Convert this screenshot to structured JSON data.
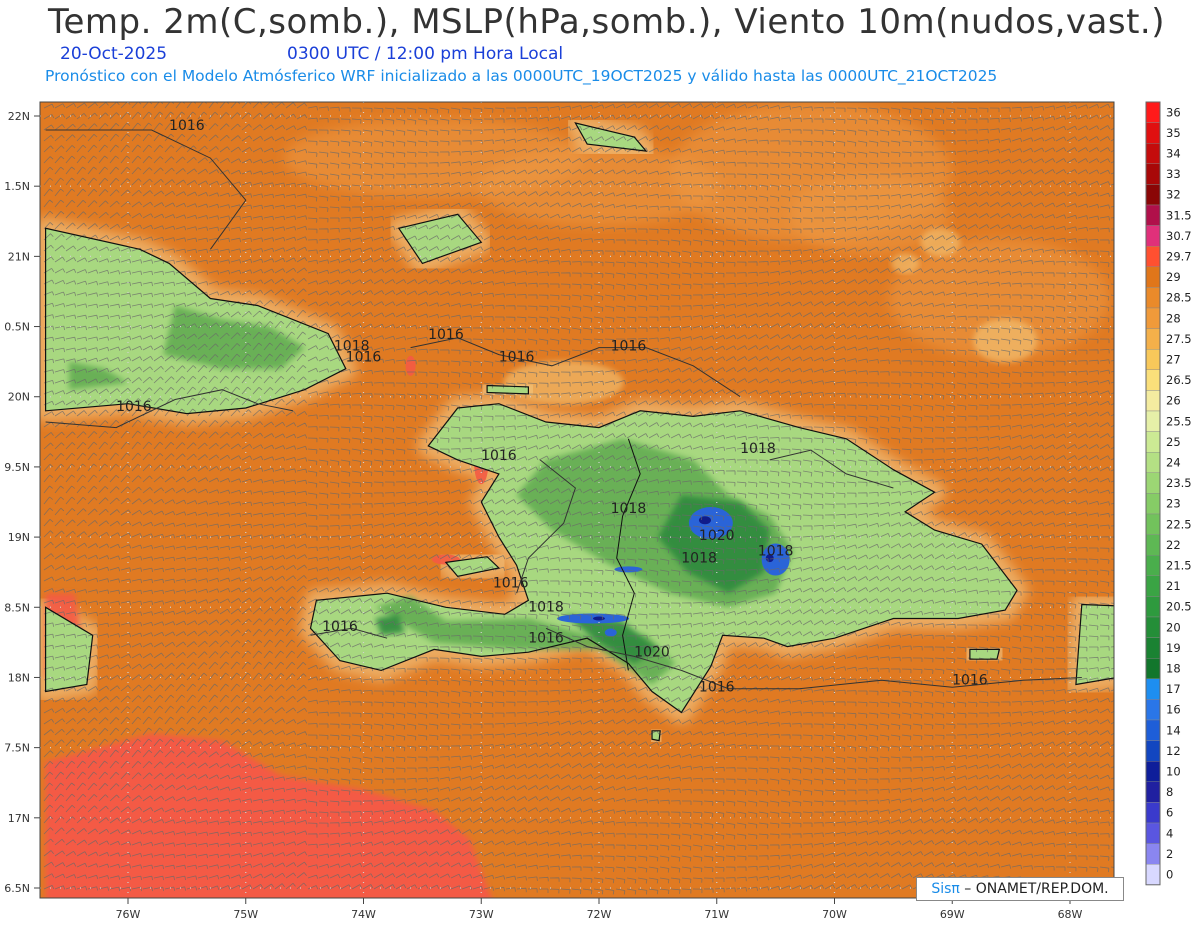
{
  "header": {
    "title": "Temp. 2m(C,somb.), MSLP(hPa,somb.), Viento 10m(nudos,vast.)",
    "date": "20-Oct-2025",
    "time": "0300 UTC / 12:00 pm Hora Local",
    "description": "Pronóstico con el Modelo Atmósferico WRF inicializado a las 0000UTC_19OCT2025 y válido hasta las  0000UTC_21OCT2025"
  },
  "credit": {
    "brand": "Sisπ",
    "org": " – ONAMET/REP.DOM."
  },
  "axes": {
    "lon_labels": [
      "76W",
      "75W",
      "74W",
      "73W",
      "72W",
      "71W",
      "70W",
      "69W",
      "68W"
    ],
    "lat_labels": [
      "22N",
      "1.5N",
      "21N",
      "0.5N",
      "20N",
      "9.5N",
      "19N",
      "8.5N",
      "18N",
      "7.5N",
      "17N",
      "6.5N"
    ]
  },
  "isobar_labels": [
    {
      "text": "1016",
      "lon": -75.5,
      "lat": 21.9
    },
    {
      "text": "1016",
      "lon": -73.3,
      "lat": 20.41
    },
    {
      "text": "1016",
      "lon": -72.7,
      "lat": 20.25
    },
    {
      "text": "1016",
      "lon": -71.75,
      "lat": 20.33
    },
    {
      "text": "1018",
      "lon": -74.1,
      "lat": 20.33
    },
    {
      "text": "1016",
      "lon": -74.0,
      "lat": 20.25
    },
    {
      "text": "1016",
      "lon": -75.95,
      "lat": 19.9
    },
    {
      "text": "1016",
      "lon": -72.85,
      "lat": 19.55
    },
    {
      "text": "1018",
      "lon": -71.75,
      "lat": 19.17
    },
    {
      "text": "1018",
      "lon": -70.65,
      "lat": 19.6
    },
    {
      "text": "1020",
      "lon": -71.0,
      "lat": 18.98
    },
    {
      "text": "1018",
      "lon": -71.15,
      "lat": 18.82
    },
    {
      "text": "1018",
      "lon": -70.5,
      "lat": 18.87
    },
    {
      "text": "1016",
      "lon": -72.75,
      "lat": 18.64
    },
    {
      "text": "1018",
      "lon": -72.45,
      "lat": 18.47
    },
    {
      "text": "1016",
      "lon": -72.45,
      "lat": 18.25
    },
    {
      "text": "1020",
      "lon": -71.55,
      "lat": 18.15
    },
    {
      "text": "1016",
      "lon": -74.2,
      "lat": 18.33
    },
    {
      "text": "1016",
      "lon": -71.0,
      "lat": 17.9
    },
    {
      "text": "1016",
      "lon": -68.85,
      "lat": 17.95
    }
  ],
  "colorbar": {
    "labels": [
      "36",
      "35",
      "34",
      "33",
      "32",
      "31.5",
      "30.7",
      "29.7",
      "29",
      "28.5",
      "28",
      "27.5",
      "27",
      "26.5",
      "26",
      "25.5",
      "25",
      "24",
      "23.5",
      "23",
      "22.5",
      "22",
      "21.5",
      "21",
      "20.5",
      "20",
      "19",
      "18",
      "17",
      "16",
      "14",
      "12",
      "10",
      "8",
      "6",
      "4",
      "2",
      "0"
    ],
    "colors": [
      "#ff1a1a",
      "#e01010",
      "#c40c0c",
      "#a80808",
      "#8a0606",
      "#b0104a",
      "#e0307a",
      "#ff5030",
      "#e0761a",
      "#ea8a2a",
      "#f09a3a",
      "#f4b04a",
      "#f8c85a",
      "#fadf7a",
      "#f4eca0",
      "#e6f0a8",
      "#ccea94",
      "#b4e084",
      "#9cd674",
      "#86cc66",
      "#72c25c",
      "#5eb854",
      "#4aae4c",
      "#3aa444",
      "#2e9a3e",
      "#248e38",
      "#1a8232",
      "#12762c",
      "#1e8ef0",
      "#2a76e8",
      "#1e5ed8",
      "#1246c0",
      "#0e1e9a",
      "#2020a0",
      "#3a3acc",
      "#5a56e0",
      "#8a86f0",
      "#d8d8ff"
    ]
  },
  "map_colors": {
    "sea": "#e07a22",
    "warm_sea": "#f45a44",
    "lowland": "#a8d880",
    "upland": "#5eaa50",
    "mountain": "#2f8a3e",
    "peak": "#2a64d8",
    "summit": "#101c8a",
    "coast_band": "#f6d79a",
    "coastline": "#111111",
    "wind_barbs": "#6a6a6a"
  }
}
